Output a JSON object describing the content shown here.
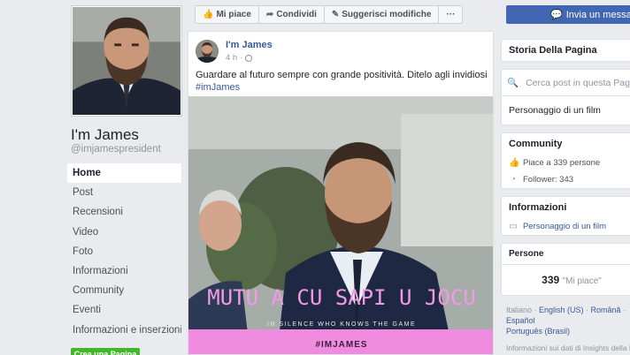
{
  "page": {
    "name": "I'm James",
    "handle": "@imjamespresident"
  },
  "nav": {
    "items": [
      {
        "label": "Home",
        "active": true
      },
      {
        "label": "Post"
      },
      {
        "label": "Recensioni"
      },
      {
        "label": "Video"
      },
      {
        "label": "Foto"
      },
      {
        "label": "Informazioni"
      },
      {
        "label": "Community"
      },
      {
        "label": "Eventi"
      },
      {
        "label": "Informazioni e inserzioni"
      }
    ],
    "create_page": "Crea una Pagina"
  },
  "actions": {
    "like": "Mi piace",
    "share": "Condividi",
    "suggest": "Suggerisci modifiche",
    "more": "···",
    "message": "Invia un messaggio"
  },
  "post": {
    "author": "I'm James",
    "time": "4 h",
    "text": "Guardare al futuro sempre con grande positività. Ditelo agli invidiosi",
    "hashtag": "#imJames",
    "image": {
      "headline": "MUTU A CU SAPI U JOCU",
      "subline": "IN SILENCE WHO KNOWS THE GAME",
      "banner": "#IMJAMES"
    }
  },
  "sidebar": {
    "story_title": "Storia Della Pagina",
    "search_placeholder": "Cerca post in questa Pagina",
    "category_header": "Personaggio di un film",
    "community": {
      "title": "Community",
      "likes": "Piace a 339 persone",
      "followers": "Follower: 343"
    },
    "info": {
      "title": "Informazioni",
      "category": "Personaggio di un film"
    },
    "people": {
      "title": "Persone",
      "count": "339",
      "label": "\"Mi piace\""
    },
    "languages": {
      "current": "Italiano",
      "items": [
        "English (US)",
        "Română",
        "Español",
        "Português (Brasil)"
      ]
    },
    "insights": "Informazioni sui dati di Insights della Pagina"
  },
  "colors": {
    "brand": "#4267b2",
    "link": "#385898",
    "banner": "#f08ce0",
    "headline": "#f39ae6",
    "create_button": "#42b72a"
  }
}
